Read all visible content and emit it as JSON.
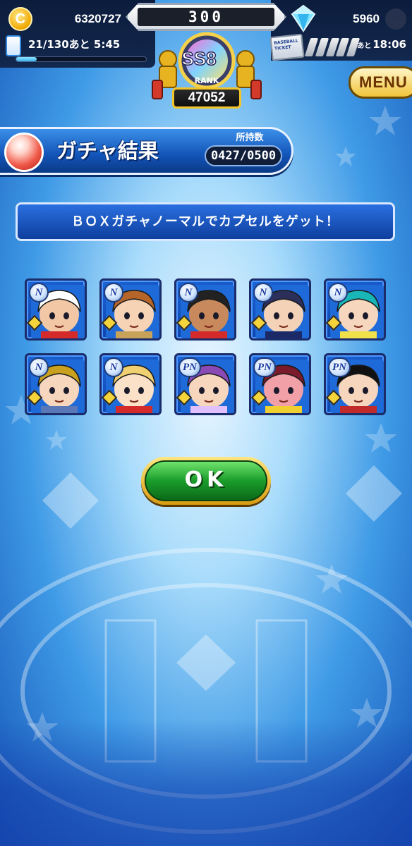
{
  "hud": {
    "coins": "6320727",
    "center_value": "300",
    "gems": "5960",
    "stamina": "21/130あと 5:45",
    "stamina_fill": 0.16,
    "ticket_timer_prefix": "あと",
    "ticket_timer": "18:06",
    "ticket_label": "BASEBALL TICKET",
    "rank_label": "RANK",
    "rank_grade": "SS8",
    "rank_points": "47052",
    "menu_label": "MENU"
  },
  "header": {
    "title": "ガチャ結果",
    "owned_label": "所持数",
    "owned_value": "0427/0500"
  },
  "message": "ＢＯＸガチャノーマルでカプセルをゲット！",
  "cards": [
    {
      "rarity": "N",
      "hair": "#ffffff",
      "skin": "#f2c7a5",
      "accent": "#d42a2a"
    },
    {
      "rarity": "N",
      "hair": "#b5652a",
      "skin": "#f6d3b5",
      "accent": "#c9a25a"
    },
    {
      "rarity": "N",
      "hair": "#222222",
      "skin": "#c88a5c",
      "accent": "#d42a2a"
    },
    {
      "rarity": "N",
      "hair": "#2b2f5a",
      "skin": "#f4d2b8",
      "accent": "#1b2a66"
    },
    {
      "rarity": "N",
      "hair": "#18b6b6",
      "skin": "#f6d7bd",
      "accent": "#f0e04a"
    },
    {
      "rarity": "N",
      "hair": "#c9a11f",
      "skin": "#f6d7bd",
      "accent": "#5a78b8"
    },
    {
      "rarity": "N",
      "hair": "#f0d070",
      "skin": "#fbe1c8",
      "accent": "#d42a2a"
    },
    {
      "rarity": "PN",
      "hair": "#8a4ab5",
      "skin": "#f6d7bd",
      "accent": "#e0c0ff"
    },
    {
      "rarity": "PN",
      "hair": "#7a1a2a",
      "skin": "#f1a0a8",
      "accent": "#f0d030"
    },
    {
      "rarity": "PN",
      "hair": "#111111",
      "skin": "#f6d7bd",
      "accent": "#c02a2a"
    }
  ],
  "ok_label": "OK"
}
